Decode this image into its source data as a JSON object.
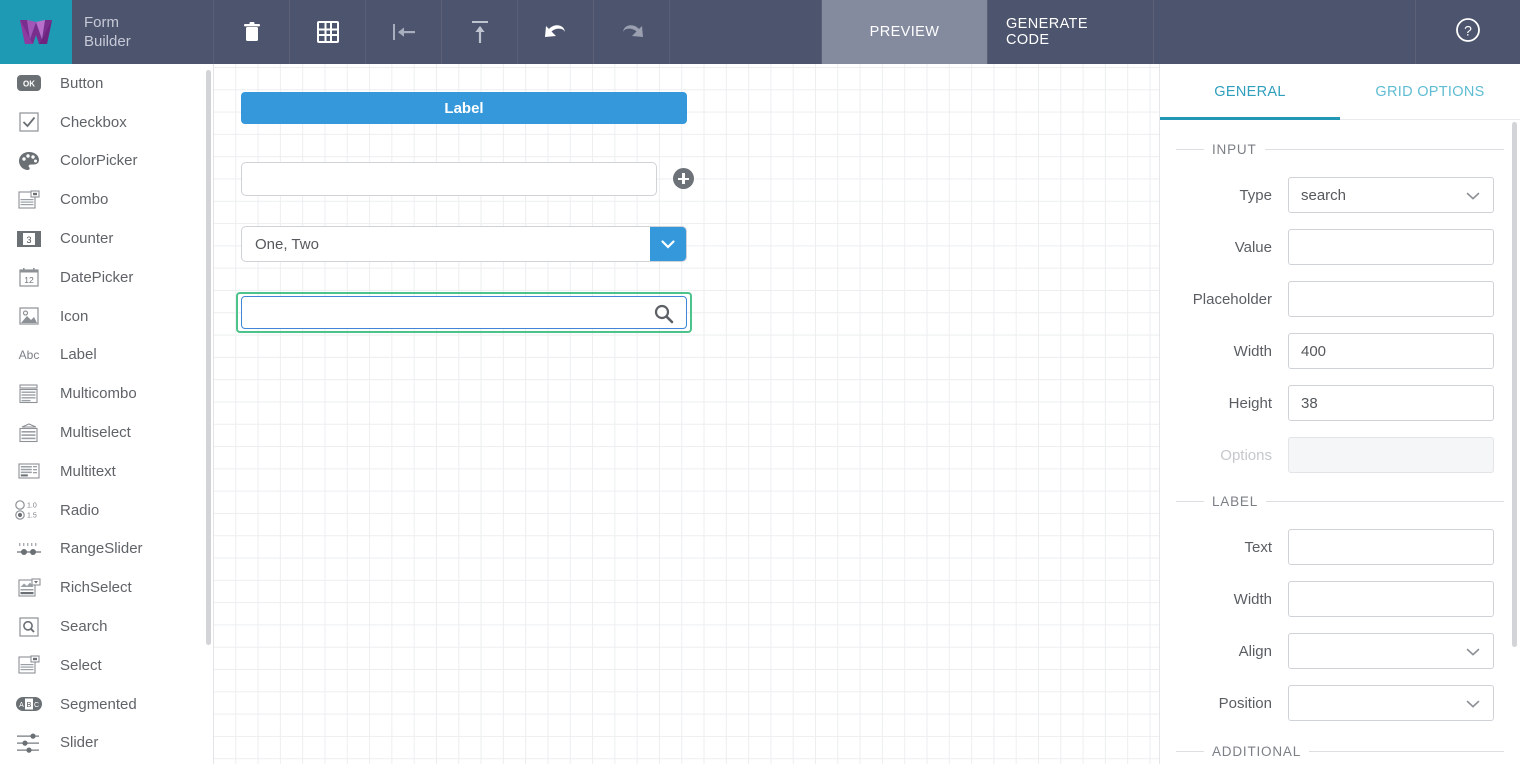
{
  "header": {
    "logo_icon": "webix-logo-icon",
    "app_title_line1": "Form",
    "app_title_line2": "Builder",
    "toolbar": [
      {
        "name": "delete-button",
        "icon": "trash-icon",
        "enabled": true
      },
      {
        "name": "grid-button",
        "icon": "grid-icon",
        "enabled": true
      },
      {
        "name": "align-left-button",
        "icon": "arrow-to-left-icon",
        "enabled": true
      },
      {
        "name": "align-top-button",
        "icon": "arrow-to-top-icon",
        "enabled": true
      },
      {
        "name": "undo-button",
        "icon": "undo-icon",
        "enabled": true
      },
      {
        "name": "redo-button",
        "icon": "redo-icon",
        "enabled": false
      }
    ],
    "preview_label": "PREVIEW",
    "generate_code_label": "GENERATE CODE",
    "help_icon": "question-circle-icon",
    "active_tab": "PREVIEW"
  },
  "sidebar": {
    "items": [
      {
        "label": "Button",
        "icon": "ok-badge-icon"
      },
      {
        "label": "Checkbox",
        "icon": "checkbox-icon"
      },
      {
        "label": "ColorPicker",
        "icon": "palette-icon"
      },
      {
        "label": "Combo",
        "icon": "combo-icon"
      },
      {
        "label": "Counter",
        "icon": "counter-icon"
      },
      {
        "label": "DatePicker",
        "icon": "calendar-icon"
      },
      {
        "label": "Icon",
        "icon": "image-icon"
      },
      {
        "label": "Label",
        "icon": "abc-text-icon"
      },
      {
        "label": "Multicombo",
        "icon": "multicombo-icon"
      },
      {
        "label": "Multiselect",
        "icon": "multiselect-icon"
      },
      {
        "label": "Multitext",
        "icon": "multitext-icon"
      },
      {
        "label": "Radio",
        "icon": "radio-icon"
      },
      {
        "label": "RangeSlider",
        "icon": "rangeslider-icon"
      },
      {
        "label": "RichSelect",
        "icon": "richselect-icon"
      },
      {
        "label": "Search",
        "icon": "search-box-icon"
      },
      {
        "label": "Select",
        "icon": "select-icon"
      },
      {
        "label": "Segmented",
        "icon": "segmented-icon"
      },
      {
        "label": "Slider",
        "icon": "slider-icon"
      }
    ]
  },
  "canvas": {
    "widgets": {
      "label_button": {
        "text": "Label"
      },
      "multitext": {
        "value": "",
        "add_icon": "plus-circle-icon"
      },
      "combo": {
        "value": "One, Two",
        "arrow_icon": "chevron-down-icon"
      },
      "search": {
        "value": "",
        "icon": "search-icon",
        "selected": true
      }
    }
  },
  "properties": {
    "tabs": [
      {
        "label": "GENERAL",
        "active": true
      },
      {
        "label": "GRID OPTIONS",
        "active": false
      }
    ],
    "sections": [
      {
        "title": "INPUT",
        "fields": [
          {
            "label": "Type",
            "value": "search",
            "type": "select",
            "disabled": false
          },
          {
            "label": "Value",
            "value": "",
            "type": "text",
            "disabled": false
          },
          {
            "label": "Placeholder",
            "value": "",
            "type": "text",
            "disabled": false
          },
          {
            "label": "Width",
            "value": "400",
            "type": "text",
            "disabled": false
          },
          {
            "label": "Height",
            "value": "38",
            "type": "text",
            "disabled": false
          },
          {
            "label": "Options",
            "value": "",
            "type": "text",
            "disabled": true
          }
        ]
      },
      {
        "title": "LABEL",
        "fields": [
          {
            "label": "Text",
            "value": "",
            "type": "text",
            "disabled": false
          },
          {
            "label": "Width",
            "value": "",
            "type": "text",
            "disabled": false
          },
          {
            "label": "Align",
            "value": "",
            "type": "select",
            "disabled": false
          },
          {
            "label": "Position",
            "value": "",
            "type": "select",
            "disabled": false
          }
        ]
      },
      {
        "title": "ADDITIONAL",
        "fields": []
      }
    ]
  },
  "colors": {
    "header_bg": "#4d546e",
    "logo_bg": "#1f9ab5",
    "active_tab_bg": "#848b9f",
    "accent_blue": "#3498db",
    "selection_green": "#4cc38a",
    "tab_teal": "#2196b5"
  }
}
